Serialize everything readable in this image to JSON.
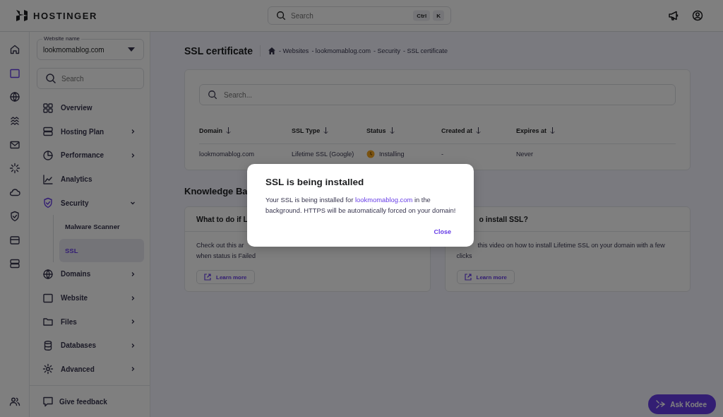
{
  "topbar": {
    "logo": "HOSTINGER",
    "search": {
      "placeholder": "Search"
    },
    "shortcut": [
      "Ctrl",
      "K"
    ]
  },
  "rail_icons": [
    {
      "selected": false
    },
    {
      "selected": true
    },
    {
      "selected": false
    },
    {
      "selected": false
    },
    {
      "selected": false
    },
    {
      "selected": false
    },
    {
      "selected": false
    },
    {
      "selected": false
    },
    {
      "selected": false
    },
    {
      "selected": false
    }
  ],
  "sidebar": {
    "website_label": "Website name",
    "website_value": "lookmomablog.com",
    "search": {
      "placeholder": "Search"
    },
    "items": [
      {
        "label": "Overview"
      },
      {
        "label": "Hosting Plan",
        "expanded": false
      },
      {
        "label": "Performance",
        "expanded": false
      },
      {
        "label": "Analytics"
      },
      {
        "label": "Security",
        "expanded": true,
        "children": [
          {
            "label": "Malware Scanner",
            "selected": false
          },
          {
            "label": "SSL",
            "selected": true
          }
        ]
      },
      {
        "label": "Domains",
        "expanded": false
      },
      {
        "label": "Website",
        "expanded": false
      },
      {
        "label": "Files",
        "expanded": false
      },
      {
        "label": "Databases",
        "expanded": false
      },
      {
        "label": "Advanced",
        "expanded": false
      }
    ],
    "feedback": "Give feedback"
  },
  "page": {
    "title": "SSL certificate",
    "breadcrumb": [
      "- Websites",
      "- lookmomablog.com",
      "- Security",
      "- SSL certificate"
    ],
    "table": {
      "search": {
        "placeholder": "Search..."
      },
      "columns": [
        "Domain",
        "SSL Type",
        "Status",
        "Created at",
        "Expires at"
      ],
      "rows": [
        {
          "domain": "lookmomablog.com",
          "ssl_type": "Lifetime SSL (Google)",
          "status": "Installing",
          "created_at": "-",
          "expires_at": "Never"
        }
      ]
    },
    "kb_title": "Knowledge Ba",
    "kb_cards": [
      {
        "title": "What to do if L",
        "lines": [
          "Check out this ar",
          "when status is Failed"
        ],
        "button": "Learn more",
        "hidden_start": false
      },
      {
        "title": "o install SSL?",
        "lines": [
          "this video on how to install Lifetime SSL on your domain with a few",
          "clicks"
        ],
        "button": "Learn more",
        "hidden_start": true
      }
    ]
  },
  "ask_button": "Ask Kodee",
  "modal": {
    "title": "SSL is being installed",
    "text_before": "Your SSL is being installed for ",
    "link": "lookmomablog.com",
    "text_after": " in the background. HTTPS will be automatically forced on your domain!",
    "button": "Close"
  }
}
